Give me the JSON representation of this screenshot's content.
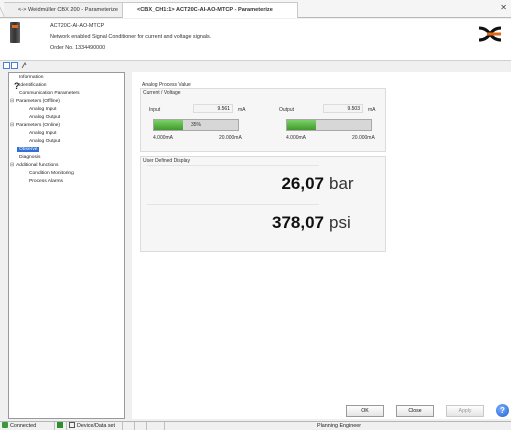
{
  "tabs": [
    {
      "label": "<-> Weidmüller CBX 200 - Parameterize"
    },
    {
      "label": "<CBX_CH1:1> ACT20C-AI-AO-MTCP - Parameterize"
    }
  ],
  "header": {
    "model": "ACT20C-AI-AO-MTCP",
    "description": "Network enabled Signal Conditioner for current and voltage signals.",
    "order_no": "Order No. 1334490000"
  },
  "tree": {
    "items": [
      {
        "label": "Information"
      },
      {
        "label": "Identification"
      },
      {
        "label": "Communication Parameters"
      },
      {
        "label": "Parameters (Offline)"
      },
      {
        "label": "Analog Input"
      },
      {
        "label": "Analog Output"
      },
      {
        "label": "Parameters (Online)"
      },
      {
        "label": "Analog Input"
      },
      {
        "label": "Analog Output"
      },
      {
        "label": "Observe"
      },
      {
        "label": "Diagnosis"
      },
      {
        "label": "Additional functions"
      },
      {
        "label": "Condition Monitoring"
      },
      {
        "label": "Process Alarms"
      }
    ]
  },
  "apv": {
    "title": "Analog Process Value",
    "subtitle": "Current / Voltage",
    "input": {
      "label": "Input",
      "value": "9.561",
      "unit": "mA",
      "bar_percent": 35,
      "bar_text": "35%",
      "min": "4.000mA",
      "max": "20.000mA"
    },
    "output": {
      "label": "Output",
      "value": "9.503",
      "unit": "mA",
      "bar_percent": 35,
      "min": "4.000mA",
      "max": "20.000mA"
    }
  },
  "udd": {
    "title": "User Defined Display",
    "row1": {
      "value": "26,07",
      "unit": "bar"
    },
    "row2": {
      "value": "378,07",
      "unit": "psi"
    }
  },
  "buttons": {
    "ok": "OK",
    "close": "Close",
    "apply": "Apply",
    "help": "?"
  },
  "status": {
    "connected": "Connected",
    "device_data_set": "Device/Data set",
    "role": "Planning Engineer"
  },
  "colors": {
    "accent": "#2f6fd6",
    "bar_fill": "#4caf38",
    "brand": "#e06a1a"
  }
}
